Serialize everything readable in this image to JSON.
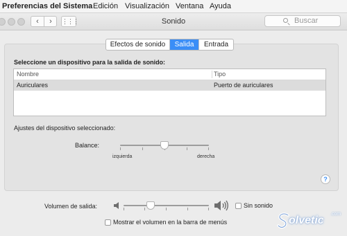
{
  "menubar": {
    "app": "Preferencias del Sistema",
    "items": [
      "Edición",
      "Visualización",
      "Ventana",
      "Ayuda"
    ]
  },
  "window": {
    "title": "Sonido",
    "back": "‹",
    "forward": "›",
    "grid_glyph": "⋮⋮⋮",
    "search_placeholder": "Buscar"
  },
  "tabs": [
    {
      "label": "Efectos de sonido",
      "active": false
    },
    {
      "label": "Salida",
      "active": true
    },
    {
      "label": "Entrada",
      "active": false
    }
  ],
  "output": {
    "select_label": "Seleccione un dispositivo para la salida de sonido:",
    "columns": [
      "Nombre",
      "Tipo"
    ],
    "rows": [
      {
        "name": "Auriculares",
        "type": "Puerto de auriculares",
        "selected": true
      }
    ],
    "device_settings_label": "Ajustes del dispositivo seleccionado:",
    "balance": {
      "label": "Balance:",
      "left_label": "izquierda",
      "right_label": "derecha",
      "value": 0.5
    }
  },
  "help_icon": "?",
  "volume": {
    "label": "Volumen de salida:",
    "value": 0.32,
    "mute_label": "Sin sonido",
    "mute_checked": false,
    "show_in_menubar_label": "Mostrar el volumen en la barra de menús",
    "show_in_menubar_checked": false
  },
  "watermark": {
    "text": "olvetic",
    "domain": ".com"
  },
  "colors": {
    "accent": "#3a8ef7",
    "selected_row": "#dcdcdc",
    "background": "#ececec"
  }
}
